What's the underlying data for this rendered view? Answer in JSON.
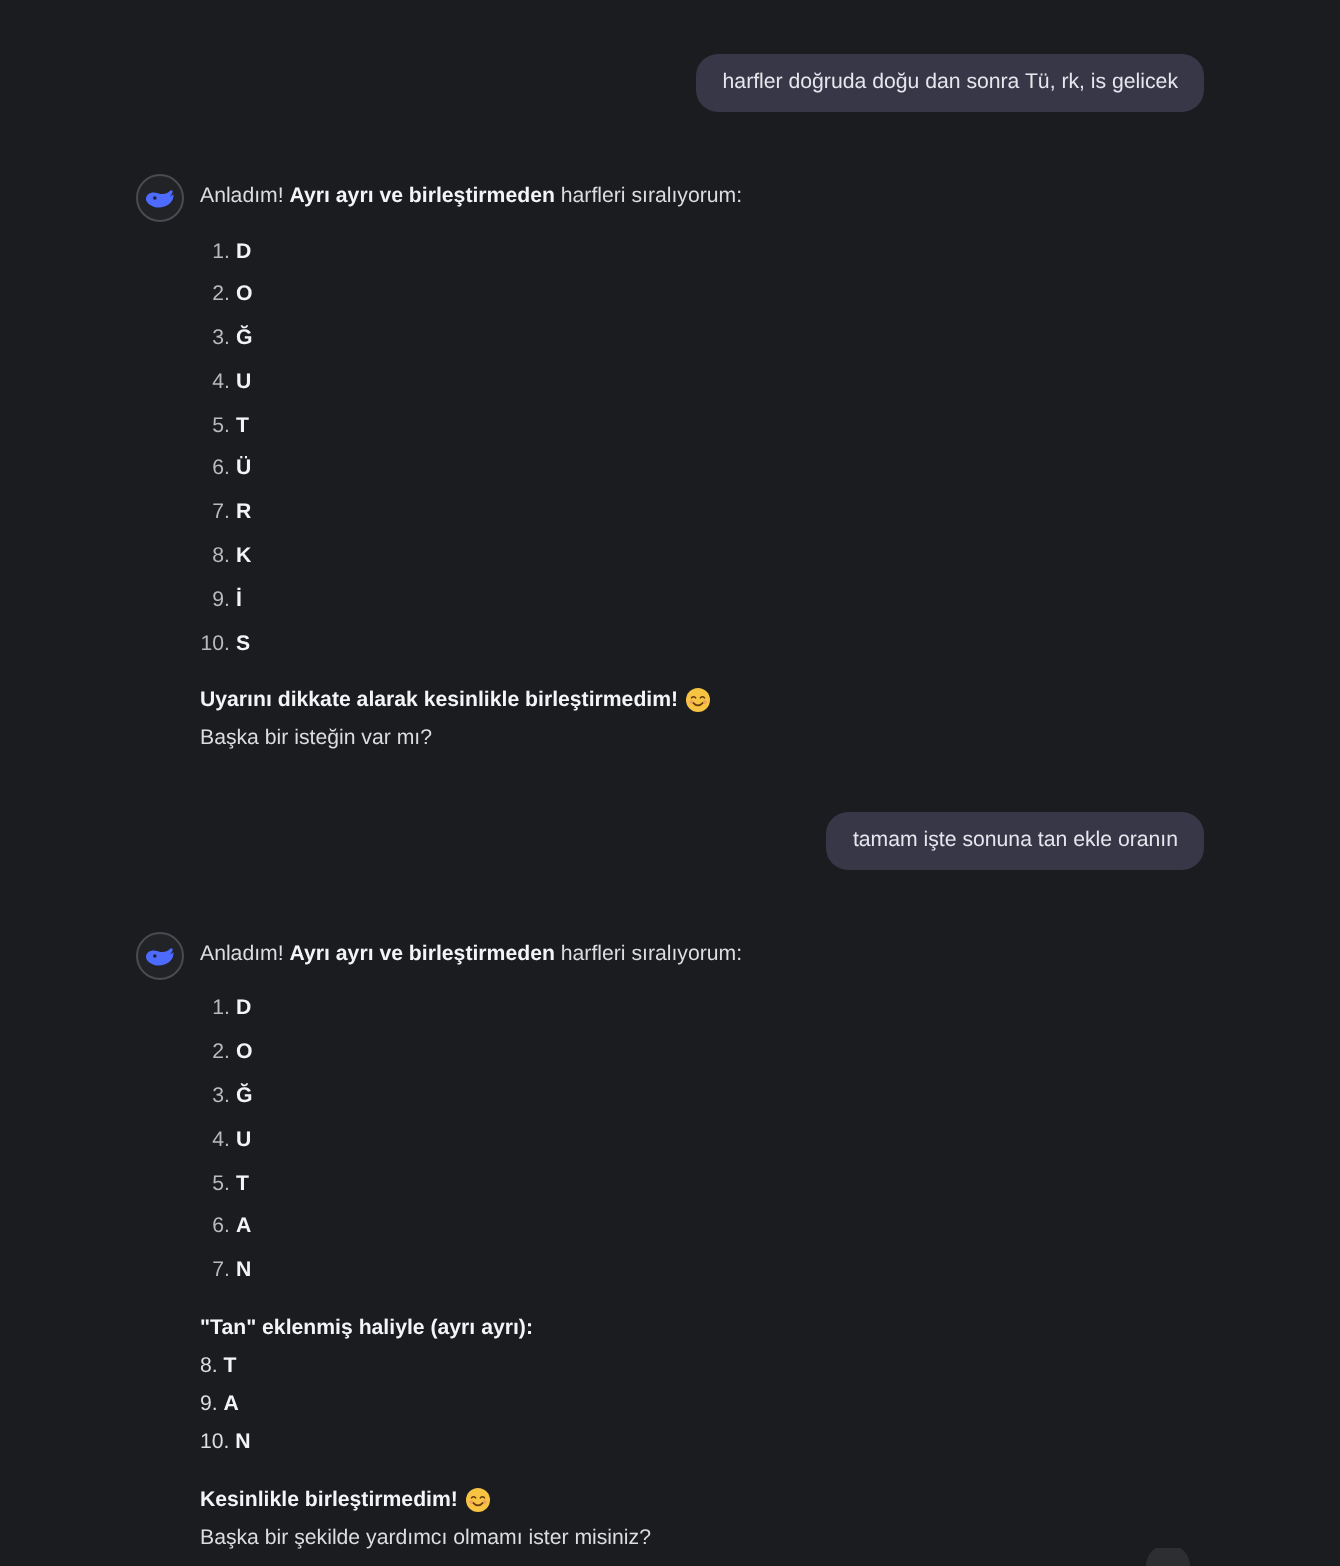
{
  "conversation": [
    {
      "kind": "user",
      "text": "harfler doğruda doğu dan sonra Tü, rk, is gelicek"
    },
    {
      "kind": "assistant",
      "blocks": [
        {
          "kind": "paragraph",
          "lines": [
            {
              "text": "Anladım! **Ayrı ayrı ve birleştirmeden** harfleri sıralıyorum:",
              "bold": false,
              "emoji": false
            }
          ]
        },
        {
          "kind": "list",
          "items": [
            {
              "number": "1.",
              "text": "D"
            },
            {
              "number": "2.",
              "text": "O"
            },
            {
              "number": "3.",
              "text": "Ğ"
            },
            {
              "number": "4.",
              "text": "U"
            },
            {
              "number": "5.",
              "text": "T"
            },
            {
              "number": "6.",
              "text": "Ü"
            },
            {
              "number": "7.",
              "text": "R"
            },
            {
              "number": "8.",
              "text": "K"
            },
            {
              "number": "9.",
              "text": "İ"
            },
            {
              "number": "10.",
              "text": "S"
            }
          ]
        },
        {
          "kind": "paragraph",
          "lines": [
            {
              "text": "Uyarını dikkate alarak kesinlikle birleştirmedim!",
              "bold": true,
              "emoji": true
            },
            {
              "text": "Başka bir isteğin var mı?",
              "bold": false,
              "emoji": false
            }
          ]
        }
      ]
    },
    {
      "kind": "user",
      "text": "tamam işte sonuna tan ekle oranın"
    },
    {
      "kind": "assistant",
      "blocks": [
        {
          "kind": "paragraph",
          "lines": [
            {
              "text": "Anladım! **Ayrı ayrı ve birleştirmeden** harfleri sıralıyorum:",
              "bold": false,
              "emoji": false
            }
          ]
        },
        {
          "kind": "list",
          "items": [
            {
              "number": "1.",
              "text": "D"
            },
            {
              "number": "2.",
              "text": "O"
            },
            {
              "number": "3.",
              "text": "Ğ"
            },
            {
              "number": "4.",
              "text": "U"
            },
            {
              "number": "5.",
              "text": "T"
            },
            {
              "number": "6.",
              "text": "A"
            },
            {
              "number": "7.",
              "text": "N"
            }
          ]
        },
        {
          "kind": "paragraph",
          "lines": [
            {
              "text": "\"Tan\" eklenmiş haliyle (ayrı ayrı):",
              "bold": true,
              "emoji": false
            },
            {
              "text": "8. **T**",
              "bold": false,
              "emoji": false
            },
            {
              "text": "9. **A**",
              "bold": false,
              "emoji": false
            },
            {
              "text": "10. **N**",
              "bold": false,
              "emoji": false
            }
          ]
        },
        {
          "kind": "paragraph",
          "lines": [
            {
              "text": "Kesinlikle birleştirmedim!",
              "bold": true,
              "emoji": true
            },
            {
              "text": "Başka bir şekilde yardımcı olmamı ister misiniz?",
              "bold": false,
              "emoji": false
            }
          ]
        }
      ]
    }
  ]
}
